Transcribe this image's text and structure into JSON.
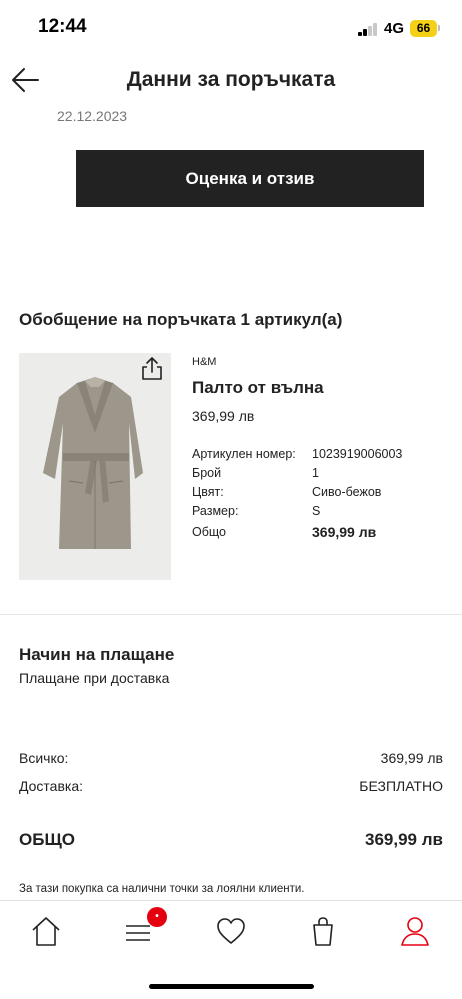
{
  "status_bar": {
    "time": "12:44",
    "network": "4G",
    "battery": "66",
    "battery_color": "#f4d117"
  },
  "header": {
    "title": "Данни за поръчката",
    "back_icon": "arrow-left-icon"
  },
  "order": {
    "date": "22.12.2023",
    "review_button": "Оценка и отзив"
  },
  "summary": {
    "title": "Обобщение на поръчката 1 артикул(а)",
    "item": {
      "brand": "H&M",
      "name": "Палто от вълна",
      "price": "369,99 лв",
      "share_icon": "share-icon",
      "details": [
        {
          "label": "Артикулен номер:",
          "value": "1023919006003"
        },
        {
          "label": "Брой",
          "value": "1"
        },
        {
          "label": "Цвят:",
          "value": "Сиво-бежов"
        },
        {
          "label": "Размер:",
          "value": "S"
        },
        {
          "label": "Общо",
          "value": "369,99 лв"
        }
      ]
    }
  },
  "payment": {
    "title": "Начин на плащане",
    "method": "Плащане при доставка"
  },
  "totals": {
    "subtotal_label": "Всичко:",
    "subtotal_value": "369,99 лв",
    "delivery_label": "Доставка:",
    "delivery_value": "БЕЗПЛАТНО",
    "total_label": "ОБЩО",
    "total_value": "369,99 лв"
  },
  "loyalty_note": "За тази покупка са налични точки за лоялни клиенти.",
  "tab_bar": {
    "items": [
      {
        "icon": "home-icon"
      },
      {
        "icon": "menu-icon"
      },
      {
        "icon": "heart-icon"
      },
      {
        "icon": "shopping-bag-icon"
      },
      {
        "icon": "account-icon"
      }
    ],
    "badge": "•",
    "accent_color": "#e50010"
  }
}
